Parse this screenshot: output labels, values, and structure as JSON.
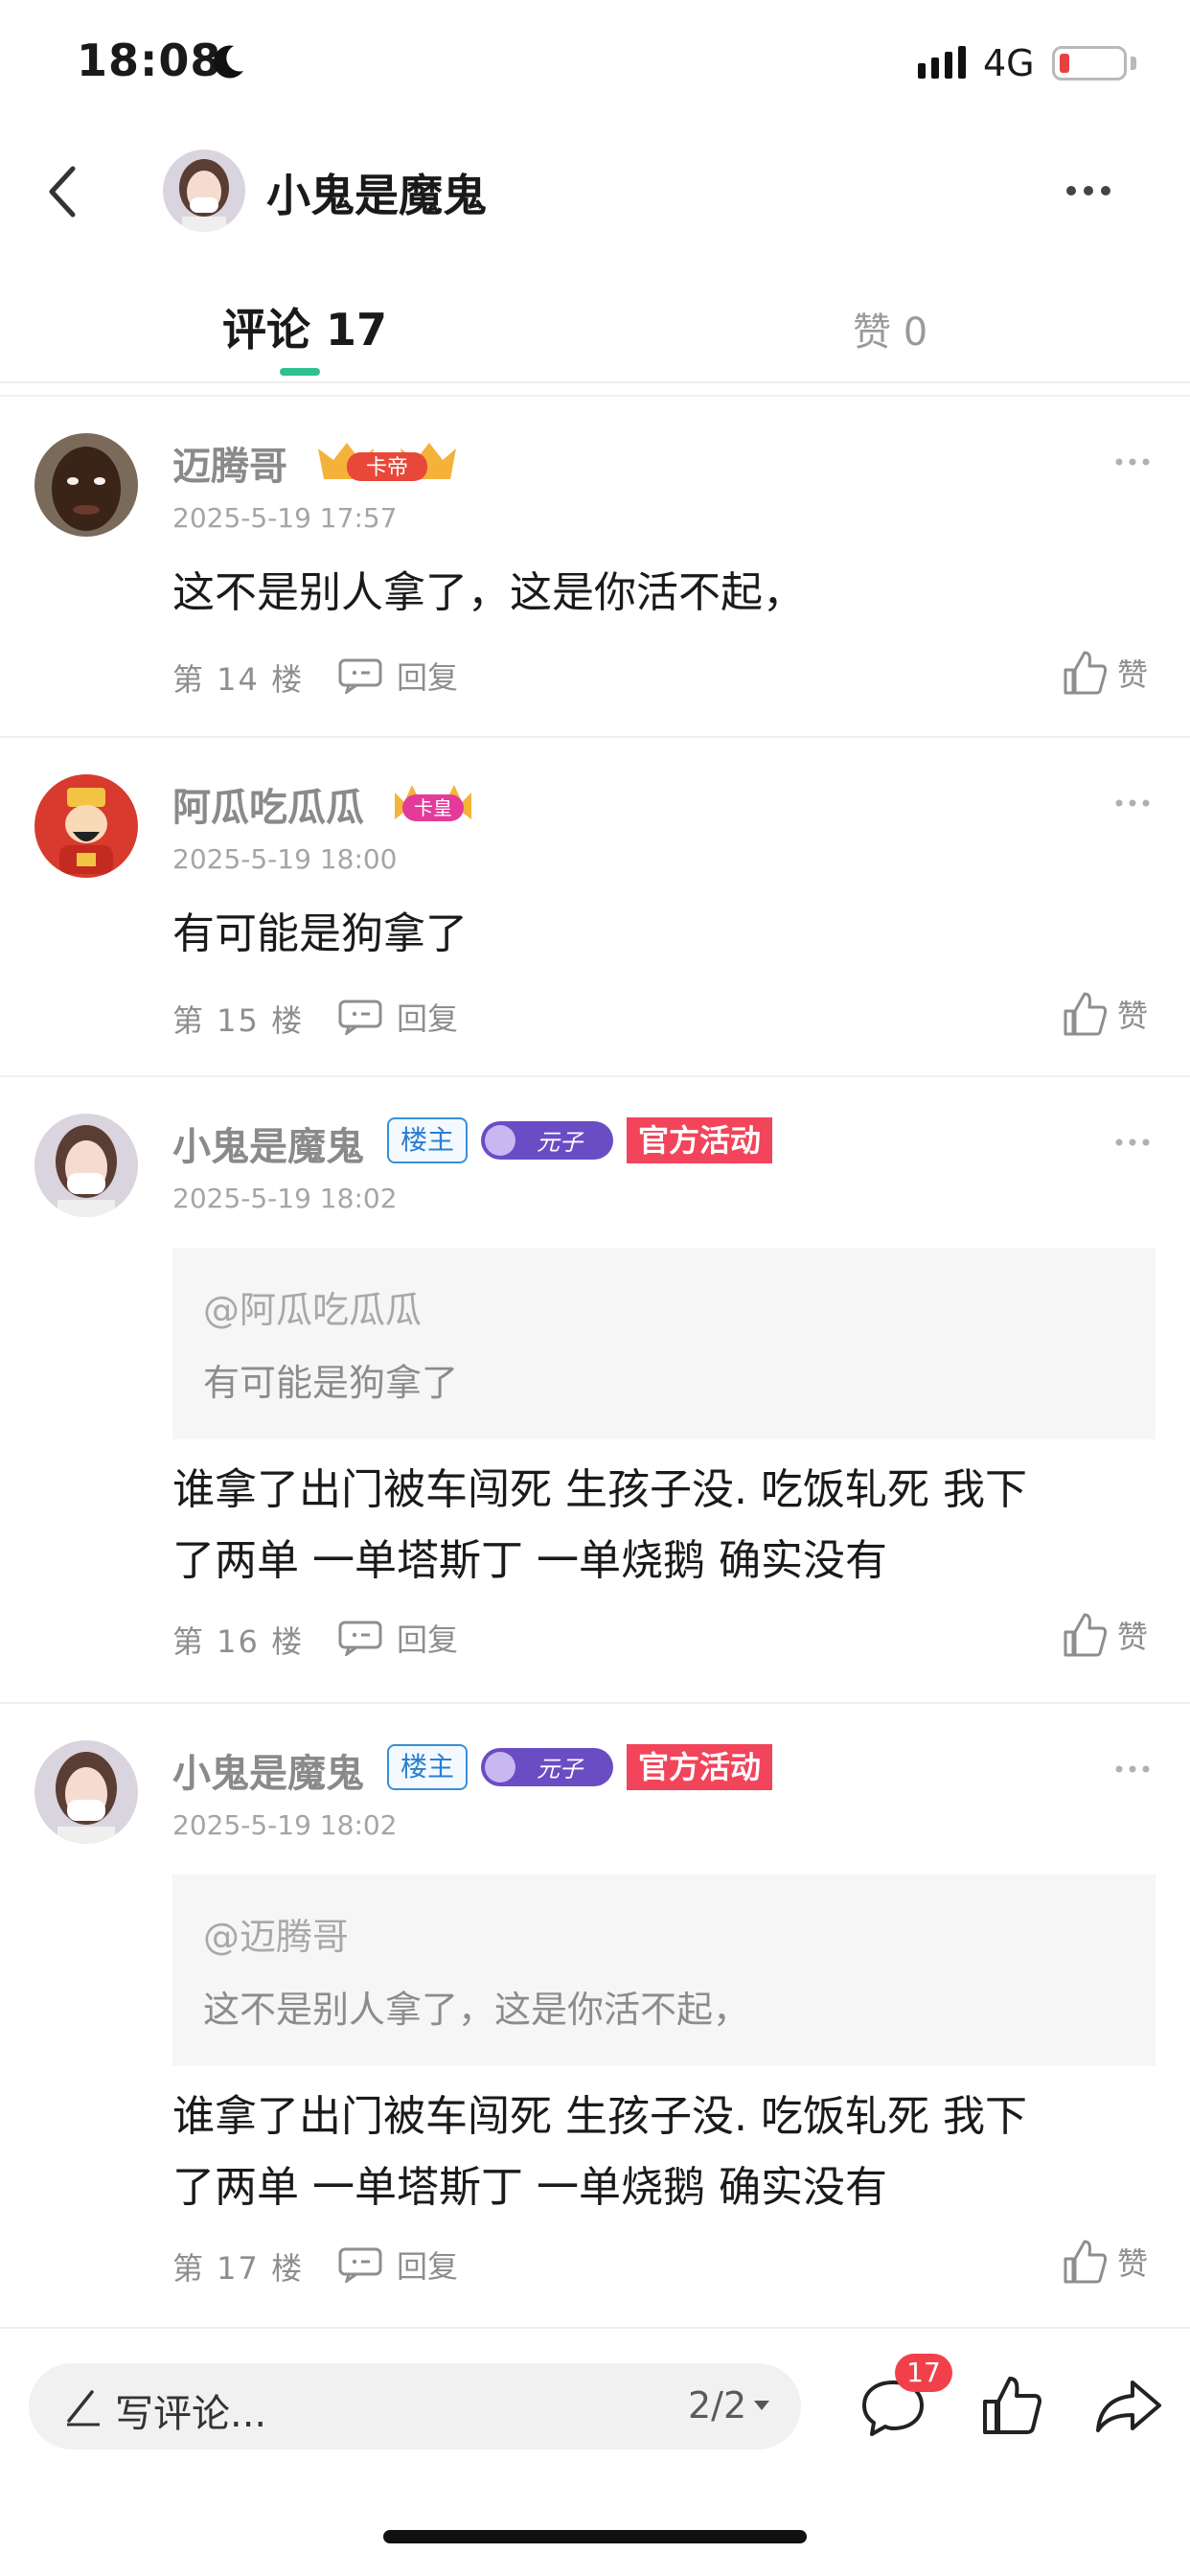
{
  "status_bar": {
    "time": "18:08",
    "network": "4G"
  },
  "header": {
    "title": "小鬼是魔鬼"
  },
  "tabs": {
    "comments": "评论 17",
    "likes": "赞 0"
  },
  "comments": [
    {
      "name": "迈腾哥",
      "badges": [
        "卡帝"
      ],
      "time": "2025-5-19 17:57",
      "text_lines": [
        "这不是别人拿了，这是你活不起，"
      ],
      "floor": "第 14 楼",
      "reply": "回复",
      "like": "赞"
    },
    {
      "name": "阿瓜吃瓜瓜",
      "badges": [
        "卡皇"
      ],
      "time": "2025-5-19 18:00",
      "text_lines": [
        "有可能是狗拿了"
      ],
      "floor": "第 15 楼",
      "reply": "回复",
      "like": "赞"
    },
    {
      "name": "小鬼是魔鬼",
      "owner_badge": "楼主",
      "badge_img": "元子",
      "official_badge": "官方活动",
      "time": "2025-5-19 18:02",
      "quote": {
        "at": "@阿瓜吃瓜瓜",
        "text": "有可能是狗拿了"
      },
      "text_lines": [
        "谁拿了出门被车闯死 生孩子没. 吃饭轧死 我下",
        "了两单 一单塔斯丁 一单烧鹅 确实没有"
      ],
      "floor": "第 16 楼",
      "reply": "回复",
      "like": "赞"
    },
    {
      "name": "小鬼是魔鬼",
      "owner_badge": "楼主",
      "badge_img": "元子",
      "official_badge": "官方活动",
      "time": "2025-5-19 18:02",
      "quote": {
        "at": "@迈腾哥",
        "text": "这不是别人拿了，这是你活不起，"
      },
      "text_lines": [
        "谁拿了出门被车闯死 生孩子没. 吃饭轧死 我下",
        "了两单 一单塔斯丁 一单烧鹅 确实没有"
      ],
      "floor": "第 17 楼",
      "reply": "回复",
      "like": "赞"
    }
  ],
  "bottom_bar": {
    "placeholder": "写评论...",
    "page": "2/2",
    "comment_count": "17"
  },
  "colors": {
    "accent": "#2ec08f",
    "badge_red": "#f2404a",
    "official": "#f2445a",
    "owner_blue": "#2a7fd0"
  }
}
